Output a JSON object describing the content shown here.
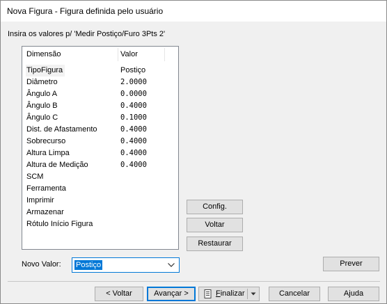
{
  "window": {
    "title": "Nova Figura - Figura definida pelo usuário"
  },
  "prompt": "Insira os valores p/ 'Medir Postiço/Furo 3Pts 2'",
  "table": {
    "columns": [
      "Dimensão",
      "Valor"
    ],
    "rows": [
      {
        "name": "TipoFigura",
        "value": "Postiço"
      },
      {
        "name": "Diâmetro",
        "value": "2.0000"
      },
      {
        "name": "Ângulo A",
        "value": "0.0000"
      },
      {
        "name": "Ângulo B",
        "value": "0.4000"
      },
      {
        "name": "Ângulo C",
        "value": "0.1000"
      },
      {
        "name": "Dist. de Afastamento",
        "value": "0.4000"
      },
      {
        "name": "Sobrecurso",
        "value": "0.4000"
      },
      {
        "name": "Altura Limpa",
        "value": "0.4000"
      },
      {
        "name": "Altura de Medição",
        "value": "0.4000"
      },
      {
        "name": "SCM",
        "value": ""
      },
      {
        "name": "Ferramenta",
        "value": ""
      },
      {
        "name": "Imprimir",
        "value": ""
      },
      {
        "name": "Armazenar",
        "value": ""
      },
      {
        "name": "Rótulo Início Figura",
        "value": ""
      }
    ],
    "selected_row": "TipoFigura"
  },
  "side_buttons": {
    "config": "Config.",
    "voltar": "Voltar",
    "restaurar": "Restaurar"
  },
  "novo_valor": {
    "label": "Novo Valor:",
    "value": "Postiço"
  },
  "prever": "Prever",
  "footer": {
    "back": "< Voltar",
    "next": "Avançar >",
    "finish_prefix": "",
    "finish_underlined": "F",
    "finish_rest": "inalizar",
    "cancel": "Cancelar",
    "help": "Ajuda"
  },
  "colors": {
    "accent": "#0078d7",
    "dialog_background": "#f0f0f0",
    "button_face": "#e1e1e1",
    "button_border": "#adadad"
  },
  "icons": {
    "finish": "document-icon",
    "finish_dropdown": "chevron-down-icon",
    "combo_dropdown": "chevron-down-icon"
  }
}
